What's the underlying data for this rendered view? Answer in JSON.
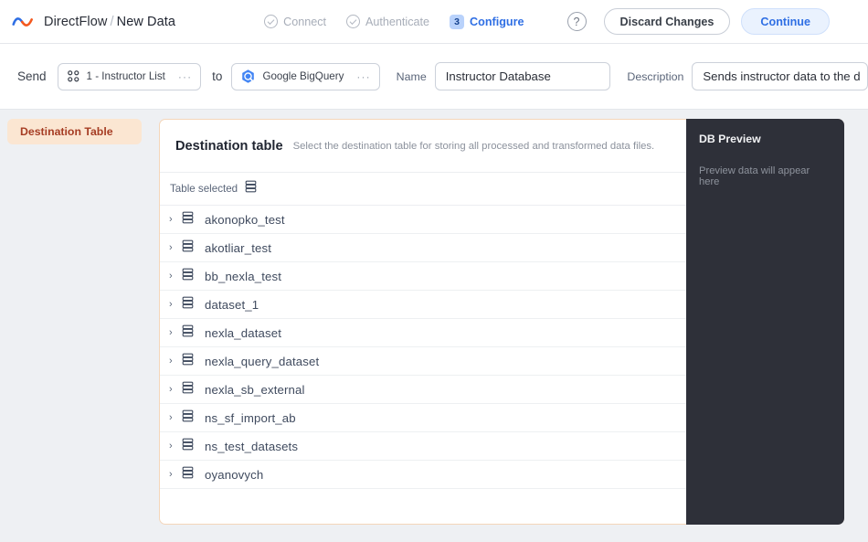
{
  "header": {
    "logo_name": "nexla-logo",
    "app_name": "DirectFlow",
    "separator": "/",
    "page_name": "New Data",
    "steps": [
      {
        "label": "Connect",
        "state": "done",
        "icon": "check-circle-icon"
      },
      {
        "label": "Authenticate",
        "state": "done",
        "icon": "check-circle-icon"
      },
      {
        "label": "Configure",
        "state": "active",
        "number": "3"
      }
    ],
    "help_label": "?",
    "discard_label": "Discard Changes",
    "continue_label": "Continue",
    "accent_blue": "#2f6fe4",
    "badge_bg": "#b9d2fb"
  },
  "toolbar": {
    "send_label": "Send",
    "source_chip": {
      "text": "1 - Instructor List",
      "icon": "grid-icon",
      "menu": "···"
    },
    "to_label": "to",
    "dest_chip": {
      "text": "Google BigQuery",
      "icon": "bigquery-icon",
      "menu": "···"
    },
    "name_label": "Name",
    "name_value": "Instructor Database",
    "name_placeholder": "Name",
    "description_label": "Description",
    "description_value": "Sends instructor data to the d",
    "description_placeholder": "Description"
  },
  "sidebar": {
    "items": [
      {
        "label": "Destination Table",
        "active": true,
        "bg": "#fbe6d2",
        "color": "#a63d24"
      }
    ]
  },
  "card": {
    "title": "Destination table",
    "subtitle": "Select the destination table for storing all processed and transformed data files.",
    "search_icon": "search-icon",
    "selected_label": "Table selected",
    "selected_icon": "database-icon",
    "refresh_icon": "refresh-icon",
    "border_color": "#f4d6ba",
    "rows": [
      {
        "name": "akonopko_test",
        "caret": "›",
        "icon": "database-icon"
      },
      {
        "name": "akotliar_test",
        "caret": "›",
        "icon": "database-icon"
      },
      {
        "name": "bb_nexla_test",
        "caret": "›",
        "icon": "database-icon"
      },
      {
        "name": "dataset_1",
        "caret": "›",
        "icon": "database-icon"
      },
      {
        "name": "nexla_dataset",
        "caret": "›",
        "icon": "database-icon"
      },
      {
        "name": "nexla_query_dataset",
        "caret": "›",
        "icon": "database-icon"
      },
      {
        "name": "nexla_sb_external",
        "caret": "›",
        "icon": "database-icon"
      },
      {
        "name": "ns_sf_import_ab",
        "caret": "›",
        "icon": "database-icon"
      },
      {
        "name": "ns_test_datasets",
        "caret": "›",
        "icon": "database-icon"
      },
      {
        "name": "oyanovych",
        "caret": "›",
        "icon": "database-icon"
      }
    ]
  },
  "db_preview": {
    "title": "DB Preview",
    "empty_text": "Preview data will appear here",
    "bg": "#2e3039"
  }
}
